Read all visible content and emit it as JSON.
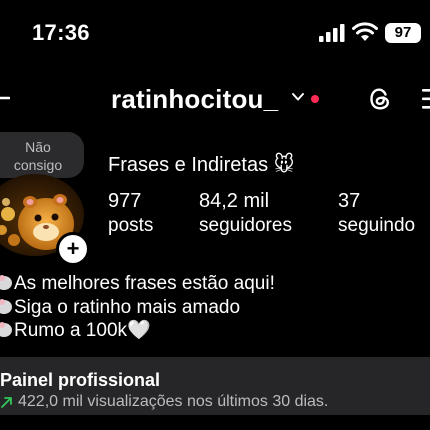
{
  "status_bar": {
    "time": "17:36",
    "battery": "97"
  },
  "header": {
    "username": "ratinhocitou_",
    "notification_color": "#ff2d55"
  },
  "note": {
    "text": "Não consigo decidir..."
  },
  "profile": {
    "full_name": "Frases e Indiretas 🐭",
    "stats": [
      {
        "value": "977",
        "label": "posts"
      },
      {
        "value": "84,2 mil",
        "label": "seguidores"
      },
      {
        "value": "37",
        "label": "seguindo"
      }
    ],
    "bio_lines": [
      "As melhores frases estão aqui!",
      "Siga o ratinho mais amado",
      "Rumo a 100k🤍"
    ]
  },
  "panel": {
    "title": "Painel profissional",
    "subtitle": "422,0 mil visualizações nos últimos 30 dias.",
    "trend_color": "#34c759"
  }
}
